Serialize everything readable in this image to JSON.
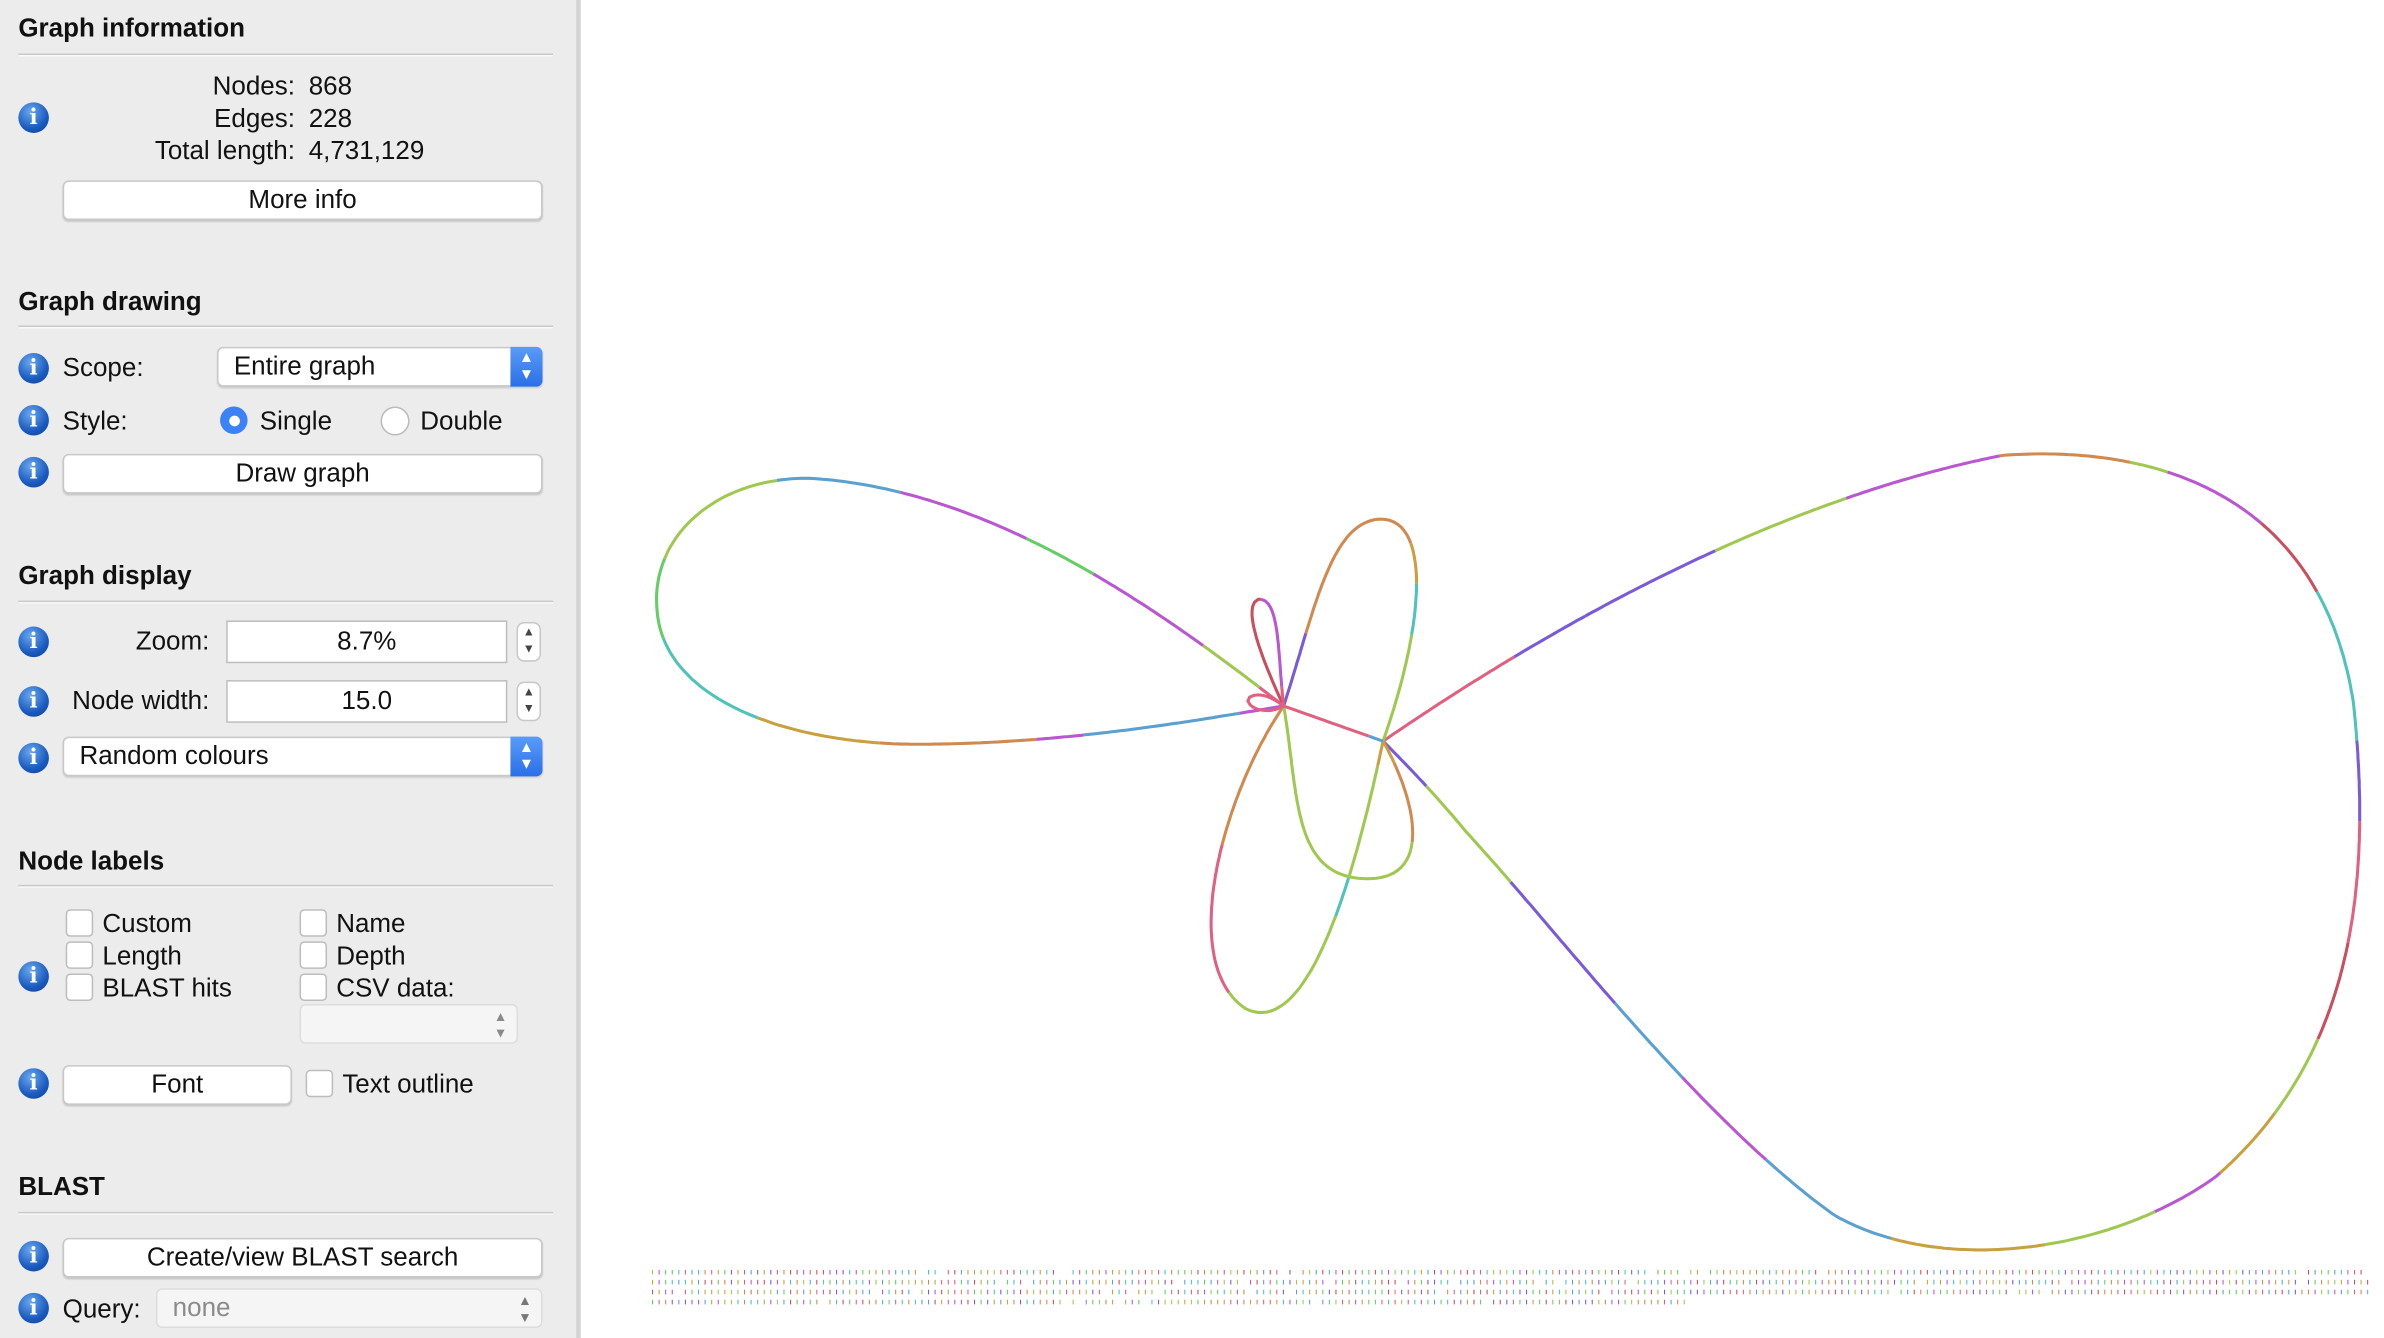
{
  "graph_information": {
    "title": "Graph information",
    "nodes_label": "Nodes:",
    "nodes": "868",
    "edges_label": "Edges:",
    "edges": "228",
    "length_label": "Total length:",
    "length": "4,731,129",
    "more_info": "More info"
  },
  "graph_drawing": {
    "title": "Graph drawing",
    "scope_label": "Scope:",
    "scope_value": "Entire graph",
    "style_label": "Style:",
    "style_single": "Single",
    "style_double": "Double",
    "style_selected": "Single",
    "draw_button": "Draw graph"
  },
  "graph_display": {
    "title": "Graph display",
    "zoom_label": "Zoom:",
    "zoom_value": "8.7%",
    "node_width_label": "Node width:",
    "node_width_value": "15.0",
    "colour_scheme": "Random colours"
  },
  "node_labels": {
    "title": "Node labels",
    "custom": "Custom",
    "name": "Name",
    "length": "Length",
    "depth": "Depth",
    "blast_hits": "BLAST hits",
    "csv_data": "CSV data:",
    "csv_value": "",
    "font_button": "Font",
    "text_outline": "Text outline"
  },
  "blast": {
    "title": "BLAST",
    "create_button": "Create/view BLAST search",
    "query_label": "Query:",
    "query_value": "none"
  },
  "colors": {
    "accent": "#3b82f6",
    "palette": [
      "#4fc3b8",
      "#c94f5f",
      "#a0c850",
      "#7a5ad8",
      "#c9a040",
      "#b957d0",
      "#5aa0d0",
      "#66cc66",
      "#d08a50",
      "#e06080"
    ]
  }
}
